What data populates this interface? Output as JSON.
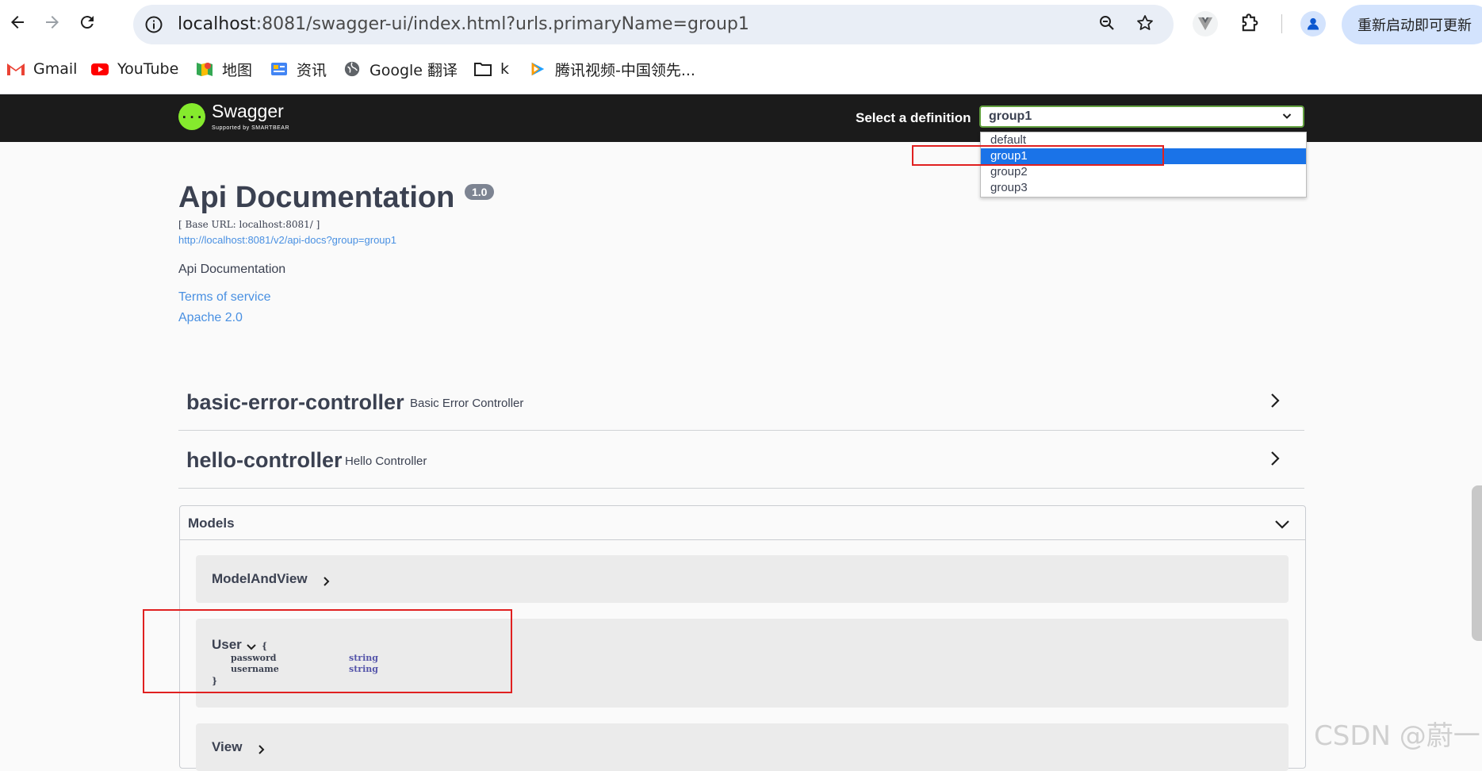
{
  "browser": {
    "url_host": "localhost",
    "url_rest": ":8081/swagger-ui/index.html?urls.primaryName=group1",
    "update_button": "重新启动即可更新"
  },
  "bookmarks": [
    {
      "label": "Gmail",
      "icon": "gmail-icon"
    },
    {
      "label": "YouTube",
      "icon": "youtube-icon"
    },
    {
      "label": "地图",
      "icon": "maps-icon"
    },
    {
      "label": "资讯",
      "icon": "news-icon"
    },
    {
      "label": "Google 翻译",
      "icon": "translate-icon"
    },
    {
      "label": "k",
      "icon": "folder-icon"
    },
    {
      "label": "腾讯视频-中国领先...",
      "icon": "tencent-video-icon"
    }
  ],
  "swagger": {
    "logo_text": "Swagger",
    "logo_sub": "Supported by SMARTBEAR",
    "select_label": "Select a definition",
    "selected": "group1",
    "options": [
      "default",
      "group1",
      "group2",
      "group3"
    ]
  },
  "info": {
    "title": "Api Documentation",
    "version": "1.0",
    "base_url": "[ Base URL: localhost:8081/ ]",
    "api_url": "http://localhost:8081/v2/api-docs?group=group1",
    "description": "Api Documentation",
    "terms": "Terms of service",
    "license": "Apache 2.0"
  },
  "tags": [
    {
      "name": "basic-error-controller",
      "description": "Basic Error Controller"
    },
    {
      "name": "hello-controller",
      "description": "Hello Controller"
    }
  ],
  "models": {
    "header": "Models",
    "items": [
      {
        "name": "ModelAndView"
      },
      {
        "name": "User",
        "open_brace": "{",
        "close_brace": "}",
        "props": [
          {
            "name": "password",
            "type": "string"
          },
          {
            "name": "username",
            "type": "string"
          }
        ]
      },
      {
        "name": "View"
      }
    ]
  },
  "watermark": "CSDN @蔚一",
  "colors": {
    "swagger_topbar": "#1b1b1b",
    "swagger_green": "#85ea2d",
    "link_blue": "#4990e2",
    "highlight_red": "#e02020",
    "selected_option": "#1a73e8"
  }
}
